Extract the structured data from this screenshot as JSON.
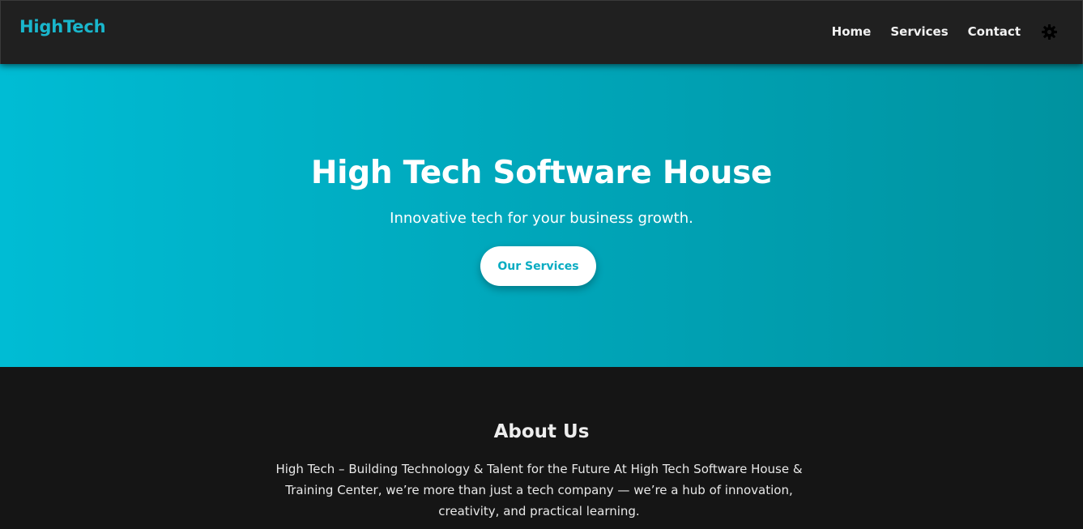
{
  "navbar": {
    "brand": "HighTech",
    "links": [
      "Home",
      "Services",
      "Contact"
    ],
    "theme_toggle_icon": "gear-icon"
  },
  "hero": {
    "title": "High Tech Software House",
    "subtitle": "Innovative tech for your business growth.",
    "button_label": "Our Services"
  },
  "about": {
    "title": "About Us",
    "text": "High Tech – Building Technology & Talent for the Future At High Tech Software House & Training Center, we’re more than just a tech company — we’re a hub of innovation, creativity, and practical learning."
  },
  "colors": {
    "accent": "#00bcd4",
    "nav_background": "#202020",
    "page_background": "#151515"
  }
}
